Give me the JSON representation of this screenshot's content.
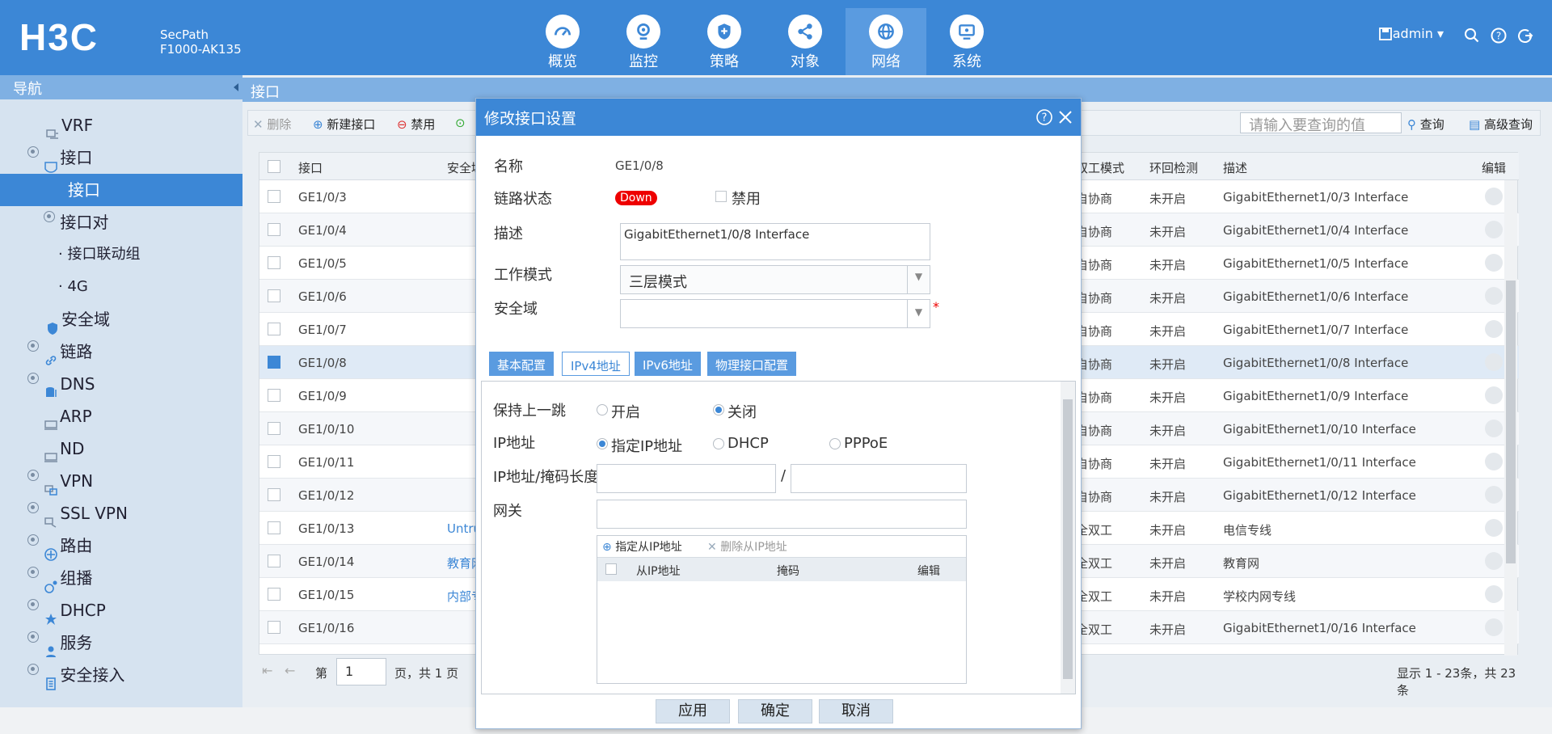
{
  "header": {
    "brand": "H3C",
    "product_line1": "SecPath",
    "product_line2": "F1000-AK135",
    "user": "admin",
    "nav": [
      {
        "label": "概览",
        "icon": "gauge-icon"
      },
      {
        "label": "监控",
        "icon": "monitor-icon"
      },
      {
        "label": "策略",
        "icon": "shield-icon"
      },
      {
        "label": "对象",
        "icon": "share-icon"
      },
      {
        "label": "网络",
        "icon": "globe-icon"
      },
      {
        "label": "系统",
        "icon": "screen-icon"
      }
    ]
  },
  "sidebar": {
    "title": "导航",
    "items": [
      {
        "label": "VRF"
      },
      {
        "label": "接口"
      },
      {
        "label": "接口"
      },
      {
        "label": "接口对"
      },
      {
        "label": "接口联动组"
      },
      {
        "label": "4G"
      },
      {
        "label": "安全域"
      },
      {
        "label": "链路"
      },
      {
        "label": "DNS"
      },
      {
        "label": "ARP"
      },
      {
        "label": "ND"
      },
      {
        "label": "VPN"
      },
      {
        "label": "SSL VPN"
      },
      {
        "label": "路由"
      },
      {
        "label": "组播"
      },
      {
        "label": "DHCP"
      },
      {
        "label": "服务"
      },
      {
        "label": "安全接入"
      }
    ]
  },
  "main": {
    "crumb": "接口",
    "toolbar": {
      "delete": "删除",
      "new": "新建接口",
      "disable": "禁用",
      "search_placeholder": "请输入要查询的值",
      "query": "查询",
      "advanced": "高级查询"
    },
    "columns": {
      "iface": "接口",
      "zone": "安全域",
      "duplex": "双工模式",
      "loop": "环回检测",
      "desc": "描述",
      "edit": "编辑"
    },
    "rows": [
      {
        "iface": "GE1/0/3",
        "zone": "",
        "duplex": "自协商",
        "loop": "未开启",
        "desc": "GigabitEthernet1/0/3 Interface"
      },
      {
        "iface": "GE1/0/4",
        "zone": "",
        "duplex": "自协商",
        "loop": "未开启",
        "desc": "GigabitEthernet1/0/4 Interface"
      },
      {
        "iface": "GE1/0/5",
        "zone": "",
        "duplex": "自协商",
        "loop": "未开启",
        "desc": "GigabitEthernet1/0/5 Interface"
      },
      {
        "iface": "GE1/0/6",
        "zone": "",
        "duplex": "自协商",
        "loop": "未开启",
        "desc": "GigabitEthernet1/0/6 Interface"
      },
      {
        "iface": "GE1/0/7",
        "zone": "",
        "duplex": "自协商",
        "loop": "未开启",
        "desc": "GigabitEthernet1/0/7 Interface"
      },
      {
        "iface": "GE1/0/8",
        "zone": "",
        "duplex": "自协商",
        "loop": "未开启",
        "desc": "GigabitEthernet1/0/8 Interface"
      },
      {
        "iface": "GE1/0/9",
        "zone": "",
        "duplex": "自协商",
        "loop": "未开启",
        "desc": "GigabitEthernet1/0/9 Interface"
      },
      {
        "iface": "GE1/0/10",
        "zone": "",
        "duplex": "自协商",
        "loop": "未开启",
        "desc": "GigabitEthernet1/0/10 Interface"
      },
      {
        "iface": "GE1/0/11",
        "zone": "",
        "duplex": "自协商",
        "loop": "未开启",
        "desc": "GigabitEthernet1/0/11 Interface"
      },
      {
        "iface": "GE1/0/12",
        "zone": "",
        "duplex": "自协商",
        "loop": "未开启",
        "desc": "GigabitEthernet1/0/12 Interface"
      },
      {
        "iface": "GE1/0/13",
        "zone": "Untru",
        "duplex": "全双工",
        "loop": "未开启",
        "desc": "电信专线"
      },
      {
        "iface": "GE1/0/14",
        "zone": "教育网",
        "duplex": "全双工",
        "loop": "未开启",
        "desc": "教育网"
      },
      {
        "iface": "GE1/0/15",
        "zone": "内部专",
        "duplex": "全双工",
        "loop": "未开启",
        "desc": "学校内网专线"
      },
      {
        "iface": "GE1/0/16",
        "zone": "",
        "duplex": "全双工",
        "loop": "未开启",
        "desc": "GigabitEthernet1/0/16 Interface"
      }
    ],
    "pager": {
      "prefix": "第",
      "page": "1",
      "suffix": "页，共 1 页",
      "summary": "显示 1 - 23条，共 23 条"
    }
  },
  "dialog": {
    "title": "修改接口设置",
    "name_label": "名称",
    "name_value": "GE1/0/8",
    "link_label": "链路状态",
    "link_status": "Down",
    "disable_label": "禁用",
    "desc_label": "描述",
    "desc_value": "GigabitEthernet1/0/8 Interface",
    "mode_label": "工作模式",
    "mode_value": "三层模式",
    "zone_label": "安全域",
    "required_mark": "*",
    "tabs": [
      "基本配置",
      "IPv4地址",
      "IPv6地址",
      "物理接口配置"
    ],
    "keep_hop_label": "保持上一跳",
    "on_label": "开启",
    "off_label": "关闭",
    "ip_label": "IP地址",
    "ip_opt1": "指定IP地址",
    "ip_opt2": "DHCP",
    "ip_opt3": "PPPoE",
    "mask_label": "IP地址/掩码长度",
    "slash": "/",
    "gw_label": "网关",
    "sub_add": "指定从IP地址",
    "sub_del": "删除从IP地址",
    "sub_cols": {
      "ip": "从IP地址",
      "mask": "掩码",
      "edit": "编辑"
    },
    "apply": "应用",
    "ok": "确定",
    "cancel": "取消"
  }
}
